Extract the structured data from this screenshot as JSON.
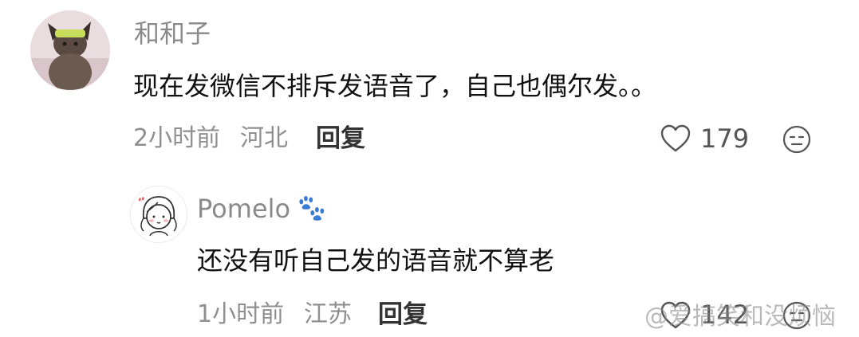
{
  "comment": {
    "username": "和和子",
    "text": "现在发微信不排斥发语音了，自己也偶尔发。。",
    "time": "2小时前",
    "location": "河北",
    "reply_label": "回复",
    "likes": "179"
  },
  "reply": {
    "username": "Pomelo",
    "text": "还没有听自己发的语音就不算老",
    "time": "1小时前",
    "location": "江苏",
    "reply_label": "回复",
    "likes": "142"
  },
  "watermark": "@爱搞笑和没烦恼",
  "colors": {
    "username": "#8a8a8a",
    "text": "#111111",
    "meta": "#8f8f8f",
    "paw": "#3a7bd5"
  }
}
